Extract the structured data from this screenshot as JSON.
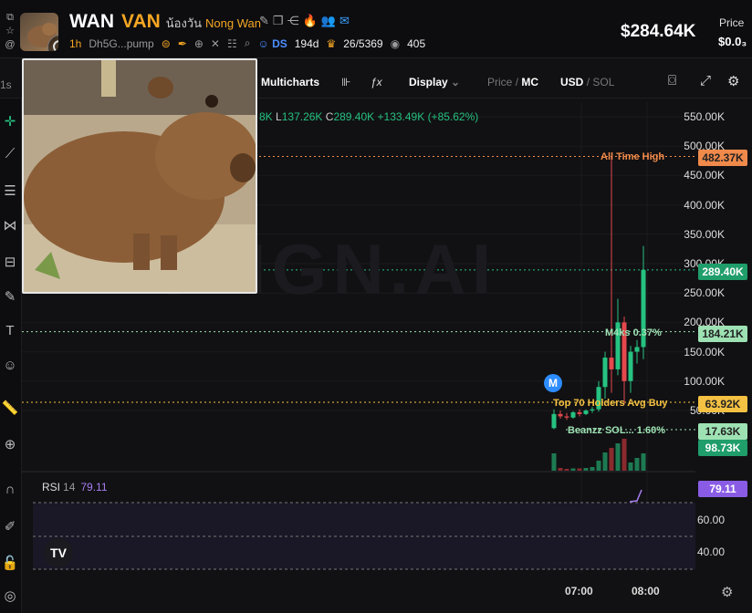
{
  "header": {
    "name": "WAN",
    "symbol": "VAN",
    "name_thai": "น้องวัน",
    "name_en": "Nong Wan",
    "timeframe": "1h",
    "address": "Dh5G...pump",
    "ds_label": "DS",
    "age": "194d",
    "holders_ratio": "26/5369",
    "watchers": "405",
    "market_cap": "$284.64K",
    "price_label": "Price",
    "price_value": "$0.0₃"
  },
  "toolbar": {
    "multicharts": "Multicharts",
    "display": "Display",
    "price": "Price",
    "mc": "MC",
    "usd": "USD",
    "sol": "SOL"
  },
  "left": {
    "interval": "1s"
  },
  "ohlc": {
    "h_tail": "8K",
    "l_label": "L",
    "l_value": "137.26K",
    "c_label": "C",
    "c_value": "289.40K",
    "change": "+133.49K (+85.62%)"
  },
  "watermark": "GMGN.AI",
  "axis": {
    "labels": [
      "550.00K",
      "500.00K",
      "450.00K",
      "400.00K",
      "350.00K",
      "300.00K",
      "250.00K",
      "200.00K",
      "150.00K",
      "100.00K",
      "50.00K"
    ],
    "rsi_labels": [
      "60.00",
      "40.00"
    ]
  },
  "tags": {
    "ath": "482.37K",
    "current": "289.40K",
    "m4ks": "184.21K",
    "top70": "63.92K",
    "beanzz": "17.63K",
    "volume": "98.73K",
    "rsi": "79.11"
  },
  "annotations": {
    "ath": "All Time High",
    "m4ks": "M4ks 0.37%",
    "top70": "Top 70 Holders Avg Buy",
    "beanzz": "Beanzz SOL... 1.60%",
    "m_badge": "M"
  },
  "rsi": {
    "label": "RSI",
    "period": "14",
    "value": "79.11"
  },
  "time_axis": [
    "07:00",
    "08:00"
  ],
  "colors": {
    "up": "#26c281",
    "down": "#e5484d",
    "ath": "#f08a4b",
    "accent": "#f5a623",
    "rsi": "#a87df0"
  },
  "chart_data": {
    "type": "candlestick",
    "ylim": [
      0,
      560000
    ],
    "candles": [
      {
        "o": 20000,
        "h": 52000,
        "l": 18000,
        "c": 44000
      },
      {
        "o": 44000,
        "h": 50000,
        "l": 36000,
        "c": 40000
      },
      {
        "o": 40000,
        "h": 46000,
        "l": 34000,
        "c": 38000
      },
      {
        "o": 38000,
        "h": 49000,
        "l": 36000,
        "c": 47000
      },
      {
        "o": 47000,
        "h": 52000,
        "l": 40000,
        "c": 44000
      },
      {
        "o": 44000,
        "h": 52000,
        "l": 42000,
        "c": 50000
      },
      {
        "o": 50000,
        "h": 56000,
        "l": 46000,
        "c": 52000
      },
      {
        "o": 52000,
        "h": 100000,
        "l": 48000,
        "c": 90000
      },
      {
        "o": 90000,
        "h": 150000,
        "l": 70000,
        "c": 140000
      },
      {
        "o": 140000,
        "h": 482370,
        "l": 80000,
        "c": 120000
      },
      {
        "o": 120000,
        "h": 240000,
        "l": 110000,
        "c": 200000
      },
      {
        "o": 200000,
        "h": 210000,
        "l": 60000,
        "c": 100000
      },
      {
        "o": 100000,
        "h": 160000,
        "l": 80000,
        "c": 150000
      },
      {
        "o": 150000,
        "h": 170000,
        "l": 130000,
        "c": 158000
      },
      {
        "o": 158000,
        "h": 330000,
        "l": 137260,
        "c": 289400
      }
    ],
    "volumes": [
      38,
      6,
      4,
      5,
      5,
      6,
      8,
      22,
      40,
      50,
      60,
      70,
      18,
      28,
      38
    ]
  }
}
